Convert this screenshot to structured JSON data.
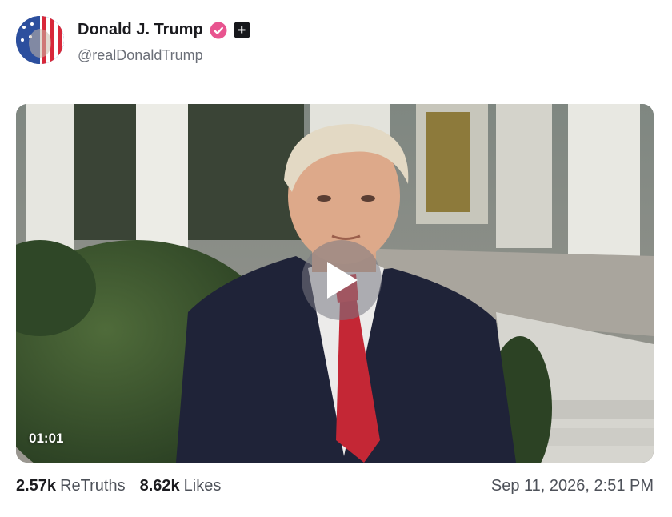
{
  "post": {
    "author": {
      "display_name": "Donald J. Trump",
      "handle": "@realDonaldTrump",
      "avatar_icon": "flag-portrait-avatar",
      "verified_icon": "verified-badge-icon",
      "verified_color": "#e8548f",
      "plus_label": "+"
    },
    "media": {
      "type": "video",
      "duration": "01:01",
      "play_icon": "play-icon"
    },
    "stats": {
      "retruths_count": "2.57k",
      "retruths_label": "ReTruths",
      "likes_count": "8.62k",
      "likes_label": "Likes"
    },
    "timestamp": "Sep 11, 2026, 2:51 PM"
  }
}
